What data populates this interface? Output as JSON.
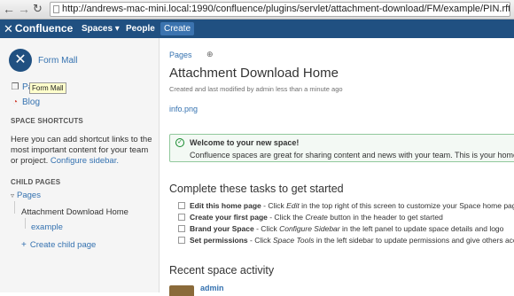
{
  "browser": {
    "url": "http://andrews-mac-mini.local:1990/confluence/plugins/servlet/attachment-download/FM/example/PIN.rft"
  },
  "header": {
    "logo": "Confluence",
    "spaces": "Spaces ▾",
    "people": "People",
    "create": "Create",
    "color": "#205081"
  },
  "sidebar": {
    "space_name": "Form Mall",
    "pages_label": "Pa",
    "tooltip": "Form Mall",
    "blog_label": "Blog",
    "shortcuts_heading": "SPACE SHORTCUTS",
    "shortcuts_text": "Here you can add shortcut links to the most important content for your team or project.",
    "configure_link": "Configure sidebar.",
    "child_pages_heading": "CHILD PAGES",
    "tree_pages": "Pages",
    "tree_home": "Attachment Download Home",
    "tree_example": "example",
    "create_child": "Create child page"
  },
  "main": {
    "breadcrumb": "Pages",
    "title": "Attachment Download Home",
    "meta": "Created and last modified by admin less than a minute ago",
    "attachment_link": "info.png",
    "welcome_title": "Welcome to your new space!",
    "welcome_text": "Confluence spaces are great for sharing content and news with your team. This is your home page.",
    "tasks_title": "Complete these tasks to get started",
    "tasks": [
      {
        "bold": "Edit this home page",
        "pre": " - Click ",
        "em": "Edit",
        "post": " in the top right of this screen to customize your Space home page"
      },
      {
        "bold": "Create your first page",
        "pre": " - Click the ",
        "em": "Create",
        "post": " button in the header to get started"
      },
      {
        "bold": "Brand your Space",
        "pre": " - Click ",
        "em": "Configure Sidebar",
        "post": " in the left panel to update space details and logo"
      },
      {
        "bold": "Set permissions",
        "pre": " - Click ",
        "em": "Space Tools",
        "post": " in the left sidebar to update permissions and give others acce"
      }
    ],
    "activity_title": "Recent space activity",
    "activity_user": "admin"
  }
}
